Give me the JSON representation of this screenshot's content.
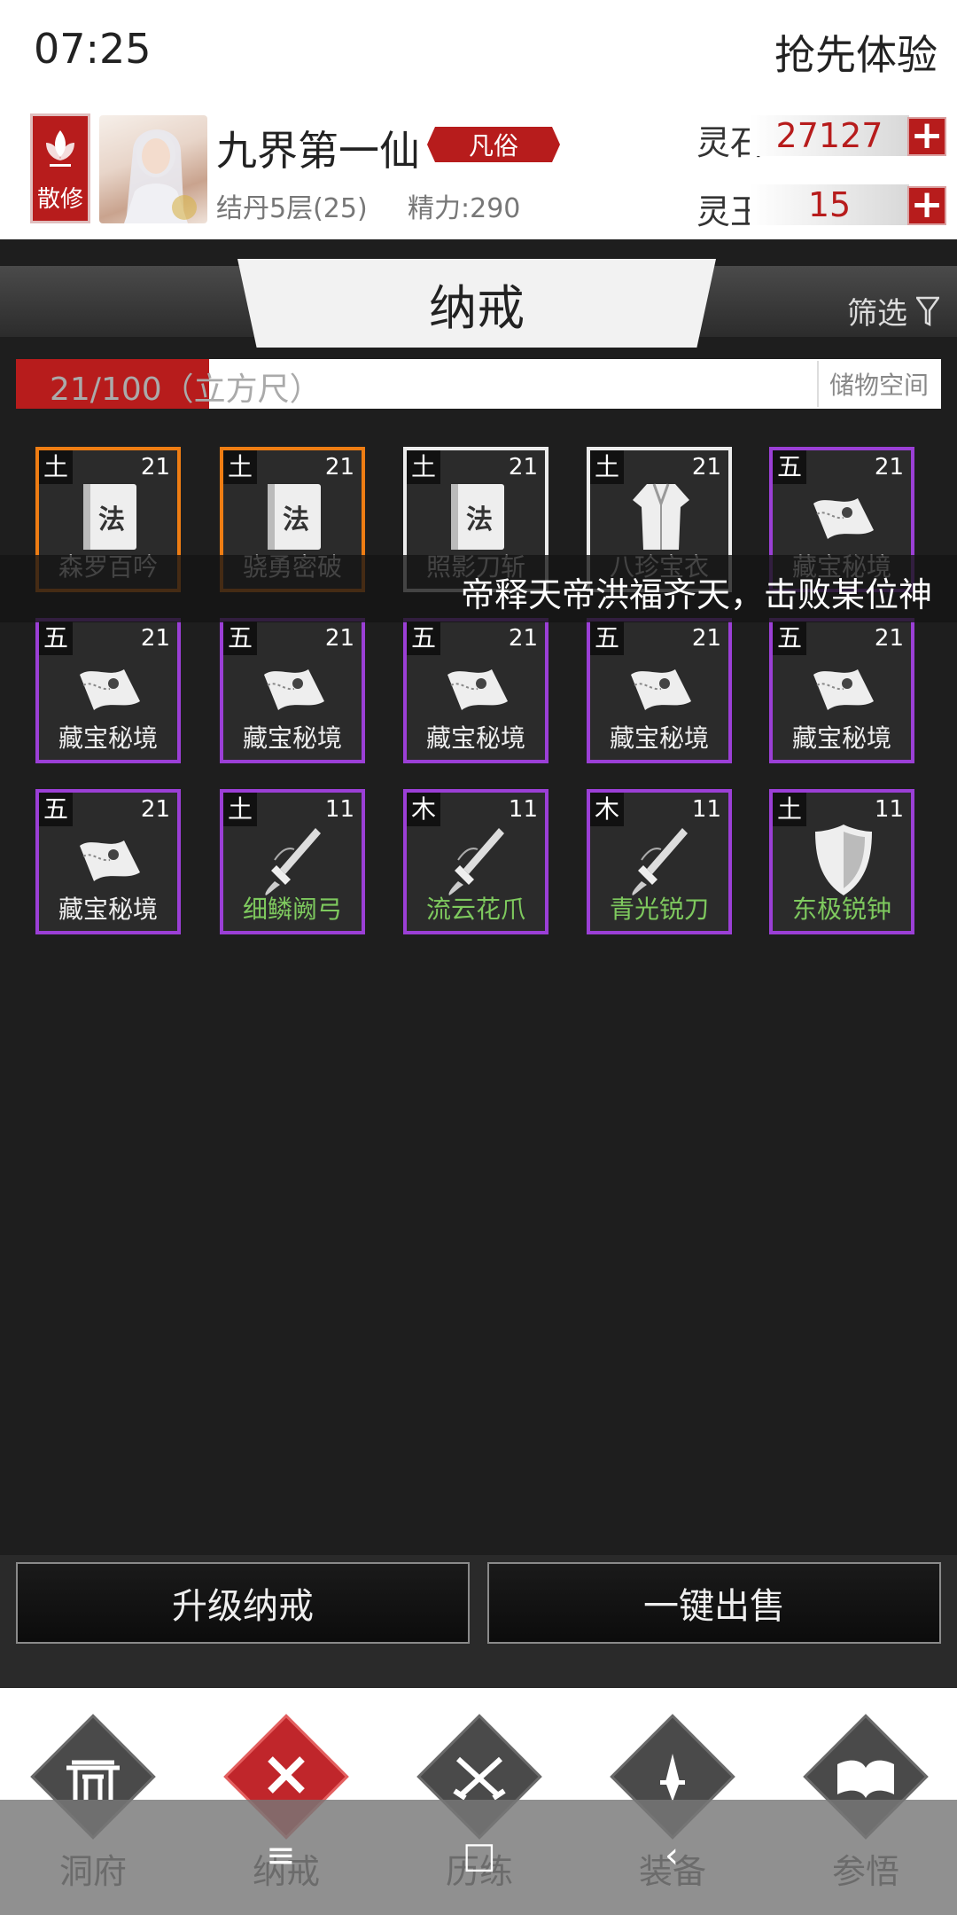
{
  "status": {
    "time": "07:25",
    "trial_label": "抢先体验"
  },
  "profile": {
    "sect": "散修",
    "name": "九界第一仙",
    "rank": "凡俗",
    "cultivation": "结丹5层(25)",
    "energy": "精力:290",
    "spirit_stone_label": "灵石",
    "spirit_stone_value": "27127",
    "spirit_jade_label": "灵玉",
    "spirit_jade_value": "15"
  },
  "panel": {
    "title": "纳戒",
    "filter_label": "筛选",
    "capacity_text": "21/100（立方尺）",
    "capacity_ratio": 0.21,
    "storage_label": "储物空间"
  },
  "marquee": "帝释天帝洪福齐天，击败某位神",
  "items": [
    {
      "element": "土",
      "level": "21",
      "name": "森罗百吟",
      "rarity": "orange",
      "icon": "manual-icon",
      "name_style": "dim"
    },
    {
      "element": "土",
      "level": "21",
      "name": "骁勇密破",
      "rarity": "orange",
      "icon": "manual-icon",
      "name_style": "dim"
    },
    {
      "element": "土",
      "level": "21",
      "name": "照影刀斩",
      "rarity": "white",
      "icon": "manual-icon",
      "name_style": "dim"
    },
    {
      "element": "土",
      "level": "21",
      "name": "八珍宝衣",
      "rarity": "white",
      "icon": "robe-icon",
      "name_style": "dim"
    },
    {
      "element": "五",
      "level": "21",
      "name": "藏宝秘境",
      "rarity": "purple",
      "icon": "map-scroll-icon",
      "name_style": "dim"
    },
    {
      "element": "五",
      "level": "21",
      "name": "藏宝秘境",
      "rarity": "purple",
      "icon": "map-scroll-icon",
      "name_style": "normal"
    },
    {
      "element": "五",
      "level": "21",
      "name": "藏宝秘境",
      "rarity": "purple",
      "icon": "map-scroll-icon",
      "name_style": "normal"
    },
    {
      "element": "五",
      "level": "21",
      "name": "藏宝秘境",
      "rarity": "purple",
      "icon": "map-scroll-icon",
      "name_style": "normal"
    },
    {
      "element": "五",
      "level": "21",
      "name": "藏宝秘境",
      "rarity": "purple",
      "icon": "map-scroll-icon",
      "name_style": "normal"
    },
    {
      "element": "五",
      "level": "21",
      "name": "藏宝秘境",
      "rarity": "purple",
      "icon": "map-scroll-icon",
      "name_style": "normal"
    },
    {
      "element": "五",
      "level": "21",
      "name": "藏宝秘境",
      "rarity": "purple",
      "icon": "map-scroll-icon",
      "name_style": "normal"
    },
    {
      "element": "土",
      "level": "11",
      "name": "细鳞阙弓",
      "rarity": "purple",
      "icon": "weapon-icon",
      "name_style": "green"
    },
    {
      "element": "木",
      "level": "11",
      "name": "流云花爪",
      "rarity": "purple",
      "icon": "weapon-icon",
      "name_style": "green"
    },
    {
      "element": "木",
      "level": "11",
      "name": "青光锐刀",
      "rarity": "purple",
      "icon": "weapon-icon",
      "name_style": "green"
    },
    {
      "element": "土",
      "level": "11",
      "name": "东极锐钟",
      "rarity": "purple",
      "icon": "shield-icon",
      "name_style": "green"
    }
  ],
  "actions": {
    "upgrade": "升级纳戒",
    "sell_all": "一键出售"
  },
  "nav": [
    {
      "label": "洞府",
      "icon": "gate-icon"
    },
    {
      "label": "纳戒",
      "icon": "close-icon"
    },
    {
      "label": "历练",
      "icon": "crossed-swords-icon"
    },
    {
      "label": "装备",
      "icon": "dagger-icon"
    },
    {
      "label": "参悟",
      "icon": "book-icon"
    }
  ],
  "colors": {
    "accent": "#b71c1c",
    "orange": "#ef7d13",
    "purple": "#9b3fd6",
    "white": "#ececec",
    "green": "#7ec95e"
  }
}
